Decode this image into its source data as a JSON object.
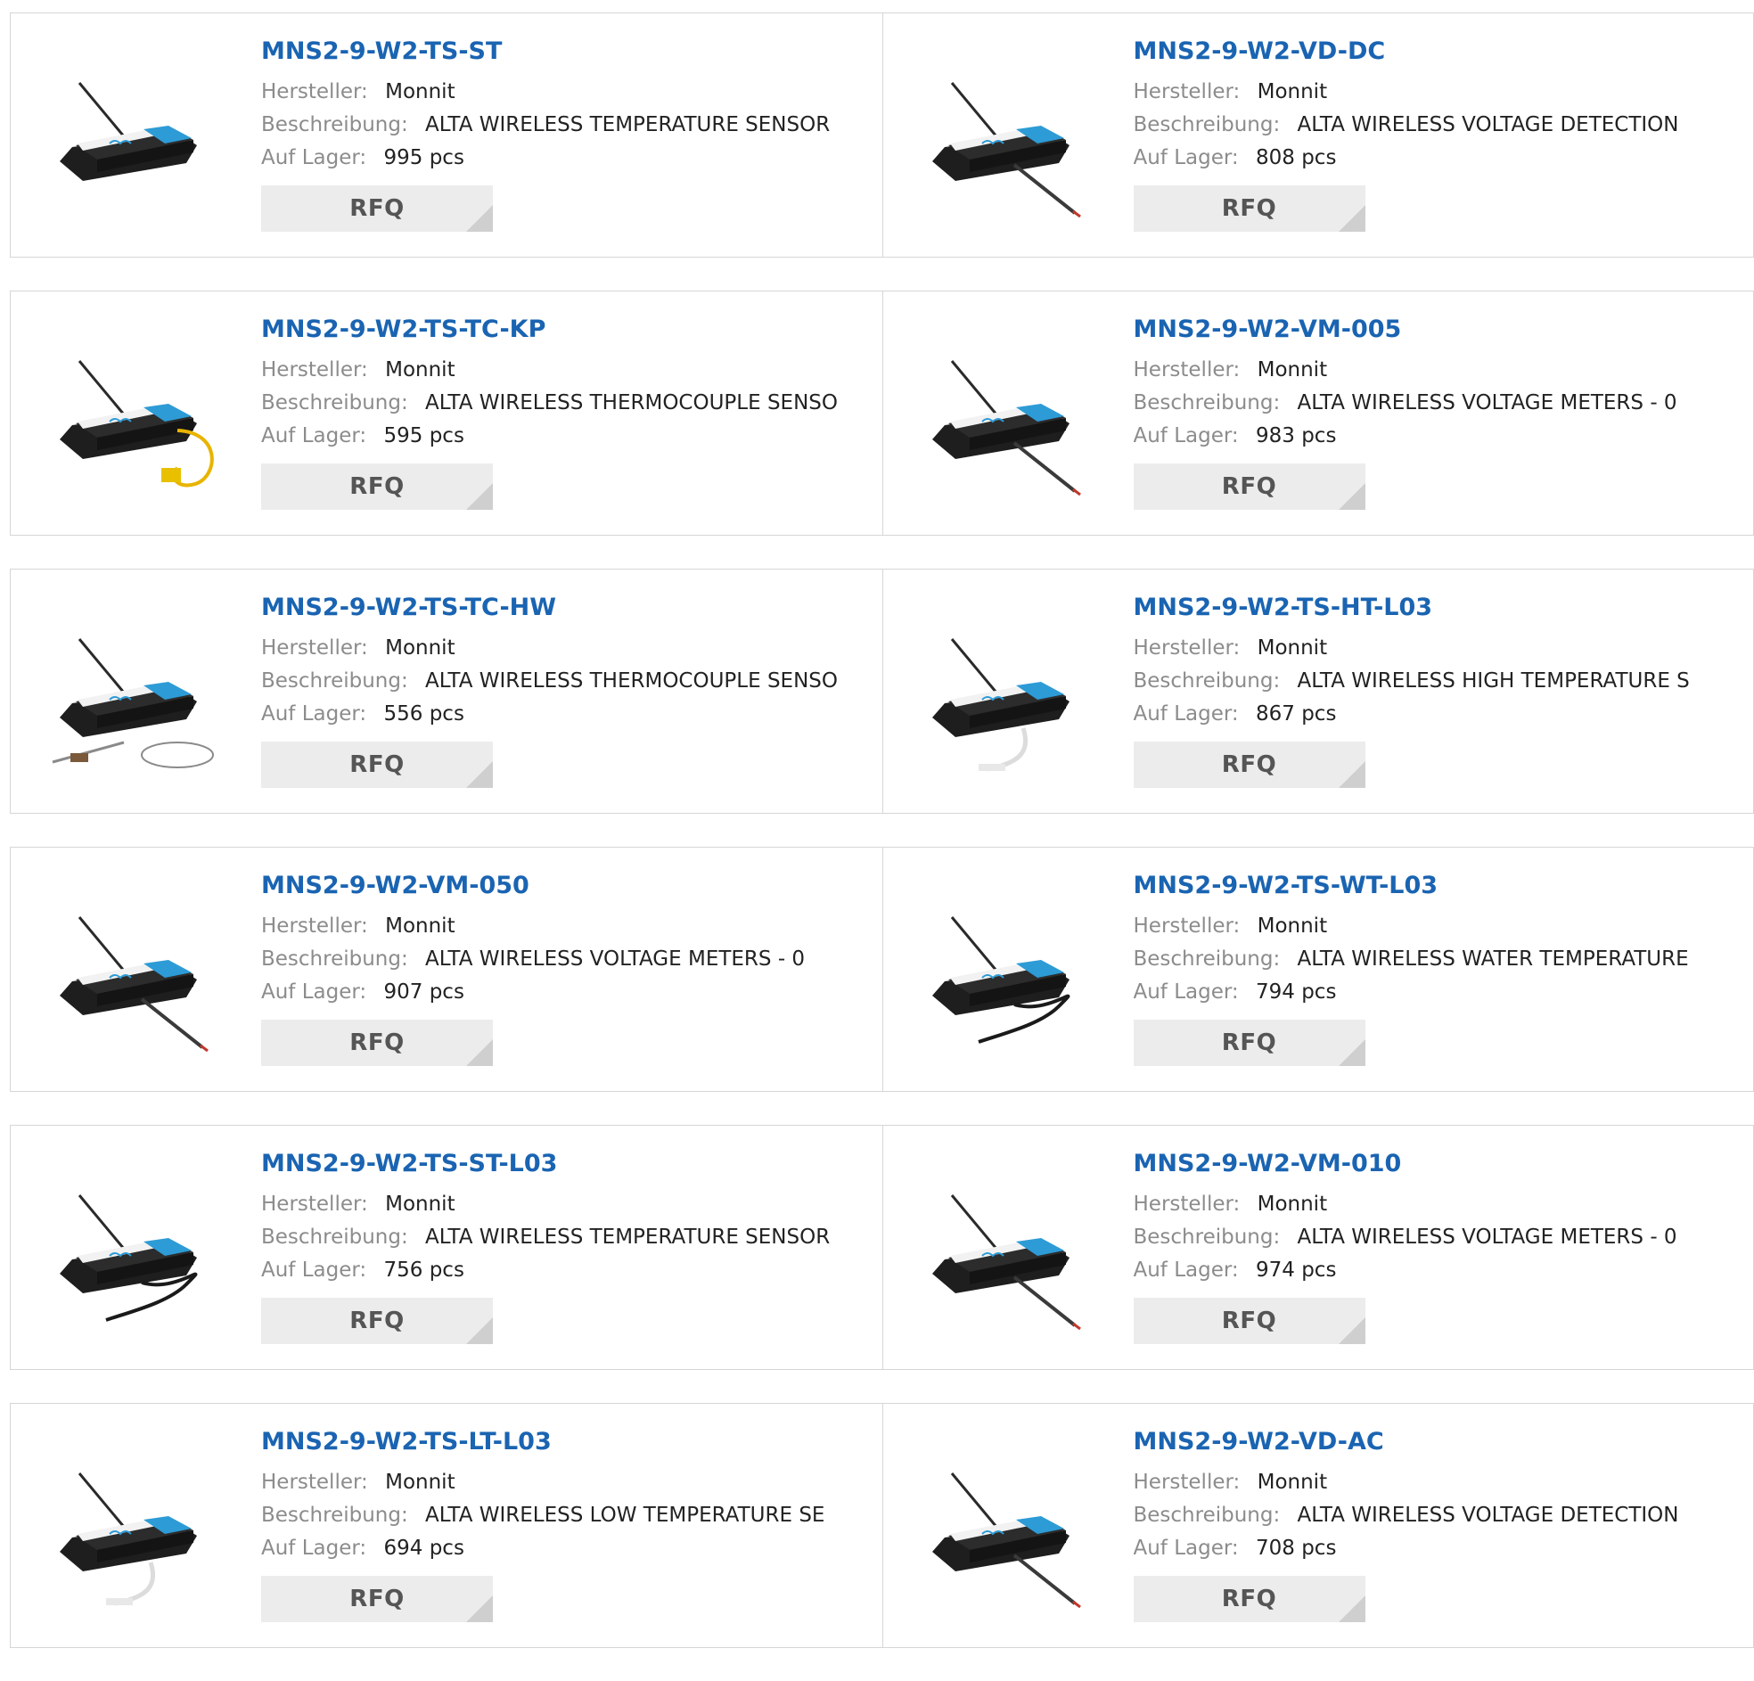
{
  "labels": {
    "manufacturer": "Hersteller:",
    "description": "Beschreibung:",
    "stock": "Auf Lager:",
    "rfq": "RFQ"
  },
  "colors": {
    "part_link": "#1a64b2",
    "label_gray": "#8c8c8c",
    "button_bg": "#ececec",
    "border": "#d6d6d6"
  },
  "products": [
    {
      "part": "MNS2-9-W2-TS-ST",
      "manufacturer": "Monnit",
      "description": "ALTA WIRELESS TEMPERATURE SENSOR",
      "stock": "995 pcs",
      "image": "sensor-plain-icon"
    },
    {
      "part": "MNS2-9-W2-VD-DC",
      "manufacturer": "Monnit",
      "description": "ALTA WIRELESS VOLTAGE DETECTION",
      "stock": "808 pcs",
      "image": "sensor-voltage-leads-icon"
    },
    {
      "part": "MNS2-9-W2-TS-TC-KP",
      "manufacturer": "Monnit",
      "description": "ALTA WIRELESS THERMOCOUPLE SENSO",
      "stock": "595 pcs",
      "image": "sensor-thermocouple-yellow-icon"
    },
    {
      "part": "MNS2-9-W2-VM-005",
      "manufacturer": "Monnit",
      "description": "ALTA WIRELESS VOLTAGE METERS - 0",
      "stock": "983 pcs",
      "image": "sensor-voltage-leads-icon"
    },
    {
      "part": "MNS2-9-W2-TS-TC-HW",
      "manufacturer": "Monnit",
      "description": "ALTA WIRELESS THERMOCOUPLE SENSO",
      "stock": "556 pcs",
      "image": "sensor-thermocouple-probe-icon"
    },
    {
      "part": "MNS2-9-W2-TS-HT-L03",
      "manufacturer": "Monnit",
      "description": "ALTA WIRELESS HIGH TEMPERATURE S",
      "stock": "867 pcs",
      "image": "sensor-white-probe-icon"
    },
    {
      "part": "MNS2-9-W2-VM-050",
      "manufacturer": "Monnit",
      "description": "ALTA WIRELESS VOLTAGE METERS - 0",
      "stock": "907 pcs",
      "image": "sensor-voltage-leads-icon"
    },
    {
      "part": "MNS2-9-W2-TS-WT-L03",
      "manufacturer": "Monnit",
      "description": "ALTA WIRELESS WATER TEMPERATURE",
      "stock": "794 pcs",
      "image": "sensor-black-cable-icon"
    },
    {
      "part": "MNS2-9-W2-TS-ST-L03",
      "manufacturer": "Monnit",
      "description": "ALTA WIRELESS TEMPERATURE SENSOR",
      "stock": "756 pcs",
      "image": "sensor-black-cable-icon"
    },
    {
      "part": "MNS2-9-W2-VM-010",
      "manufacturer": "Monnit",
      "description": "ALTA WIRELESS VOLTAGE METERS - 0",
      "stock": "974 pcs",
      "image": "sensor-voltage-leads-icon"
    },
    {
      "part": "MNS2-9-W2-TS-LT-L03",
      "manufacturer": "Monnit",
      "description": "ALTA WIRELESS LOW TEMPERATURE SE",
      "stock": "694 pcs",
      "image": "sensor-white-probe-icon"
    },
    {
      "part": "MNS2-9-W2-VD-AC",
      "manufacturer": "Monnit",
      "description": "ALTA WIRELESS VOLTAGE DETECTION",
      "stock": "708 pcs",
      "image": "sensor-voltage-leads-icon"
    }
  ]
}
